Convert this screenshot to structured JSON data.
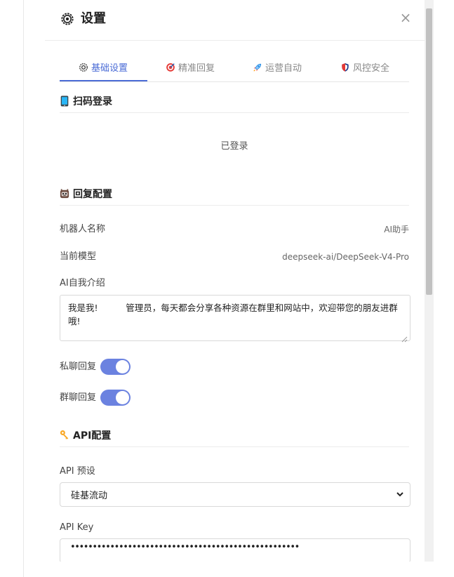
{
  "header": {
    "title": "设置",
    "close_label": "×"
  },
  "tabs": [
    {
      "label": "基础设置",
      "active": true
    },
    {
      "label": "精准回复",
      "active": false
    },
    {
      "label": "运营自动",
      "active": false
    },
    {
      "label": "风控安全",
      "active": false
    }
  ],
  "scan_login": {
    "title": "扫码登录",
    "status": "已登录"
  },
  "reply_config": {
    "title": "回复配置",
    "bot_name_label": "机器人名称",
    "bot_name_value": "AI助手",
    "model_label": "当前模型",
    "model_value": "deepseek-ai/DeepSeek-V4-Pro",
    "intro_label": "AI自我介绍",
    "intro_value": "我是我!          管理员，每天都会分享各种资源在群里和网站中，欢迎带您的朋友进群哦!",
    "private_reply_label": "私聊回复",
    "private_reply_on": true,
    "group_reply_label": "群聊回复",
    "group_reply_on": true
  },
  "api_config": {
    "title": "API配置",
    "preset_label": "API 预设",
    "preset_value": "硅基流动",
    "key_label": "API Key",
    "key_value": "••••••••••••••••••••••••••••••••••••••••••••••••••••"
  },
  "colors": {
    "accent": "#4a6bd6",
    "toggle_on": "#6b82e0"
  }
}
